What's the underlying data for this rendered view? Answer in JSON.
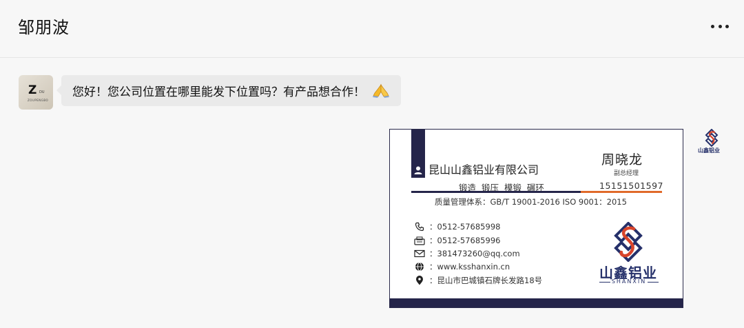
{
  "header": {
    "title": "邹朋波",
    "more_icon": "ellipsis-icon"
  },
  "messages": [
    {
      "sender": "contact",
      "avatar": {
        "letter": "Z",
        "small_text": "DU",
        "sub_text": "ZOUPENGBO"
      },
      "text": "您好！您公司位置在哪里能发下位置吗？有产品想合作！",
      "emoji_icon": "pray-hands-icon"
    },
    {
      "sender": "self",
      "type": "image",
      "business_card": {
        "company": "昆山山鑫铝业有限公司",
        "name": "周晓龙",
        "job_title": "副总经理",
        "business_scope": "锻造 锻压 模锻 碾环",
        "mobile": "15151501597",
        "quality": "质量管理体系：GB/T 19001-2016   ISO 9001：2015",
        "contacts": [
          {
            "icon": "phone-icon",
            "text": "：0512-57685998"
          },
          {
            "icon": "fax-icon",
            "text": "：0512-57685996"
          },
          {
            "icon": "email-icon",
            "text": "：381473260@qq.com"
          },
          {
            "icon": "globe-icon",
            "text": "：www.ksshanxin.cn"
          },
          {
            "icon": "location-pin-icon",
            "text": "：昆山市巴城镇石牌长发路18号"
          }
        ],
        "logo_text": "山鑫铝业",
        "logo_en": "SHANXIN"
      },
      "avatar": {
        "text": "山鑫铝业"
      }
    }
  ],
  "colors": {
    "card_navy": "#25254a",
    "card_orange": "#e06a2a",
    "logo_blue": "#25306a",
    "logo_red": "#d9452b",
    "bubble_bg": "#eaeaea"
  }
}
